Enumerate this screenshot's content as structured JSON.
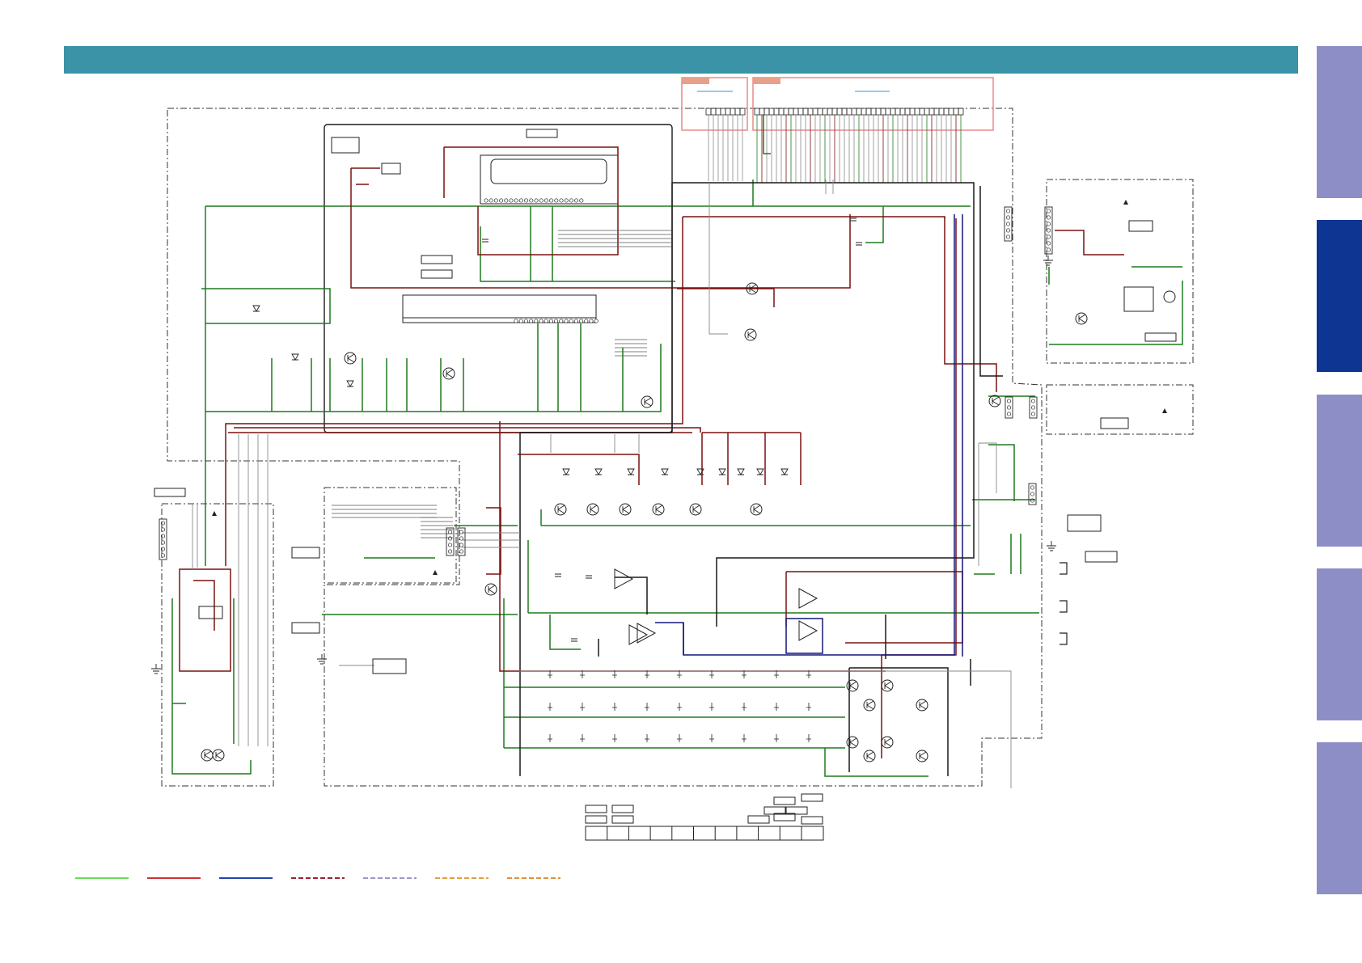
{
  "colors": {
    "header": "#3a93a6",
    "tab_inactive": "#8e8ec6",
    "tab_active": "#0f3593",
    "trace_green": "#1f7a1f",
    "trace_red": "#7a1010",
    "trace_blue": "#16167a",
    "trace_black": "#1a1a1a",
    "trace_gray": "#8a8a8a",
    "connector_box": "#e88a8a",
    "connector_tag": "#e8a08a",
    "link_blue": "#3a93d0"
  },
  "side_tabs": [
    {
      "state": "inactive"
    },
    {
      "state": "active"
    },
    {
      "state": "inactive"
    },
    {
      "state": "inactive"
    },
    {
      "state": "inactive"
    }
  ],
  "legend": [
    {
      "color": "#66dd55",
      "style": "solid"
    },
    {
      "color": "#cc3333",
      "style": "solid"
    },
    {
      "color": "#2244aa",
      "style": "solid"
    },
    {
      "color": "#992233",
      "style": "dashed"
    },
    {
      "color": "#9999cc",
      "style": "dashed"
    },
    {
      "color": "#e0a040",
      "style": "dashed"
    },
    {
      "color": "#e09040",
      "style": "dashed"
    }
  ],
  "icons": {
    "ground": "ground-symbol-icon",
    "transistor": "transistor-symbol-icon",
    "opamp": "opamp-symbol-icon",
    "led": "led-symbol-icon",
    "jack": "audio-jack-icon",
    "warning": "warning-triangle-icon"
  }
}
